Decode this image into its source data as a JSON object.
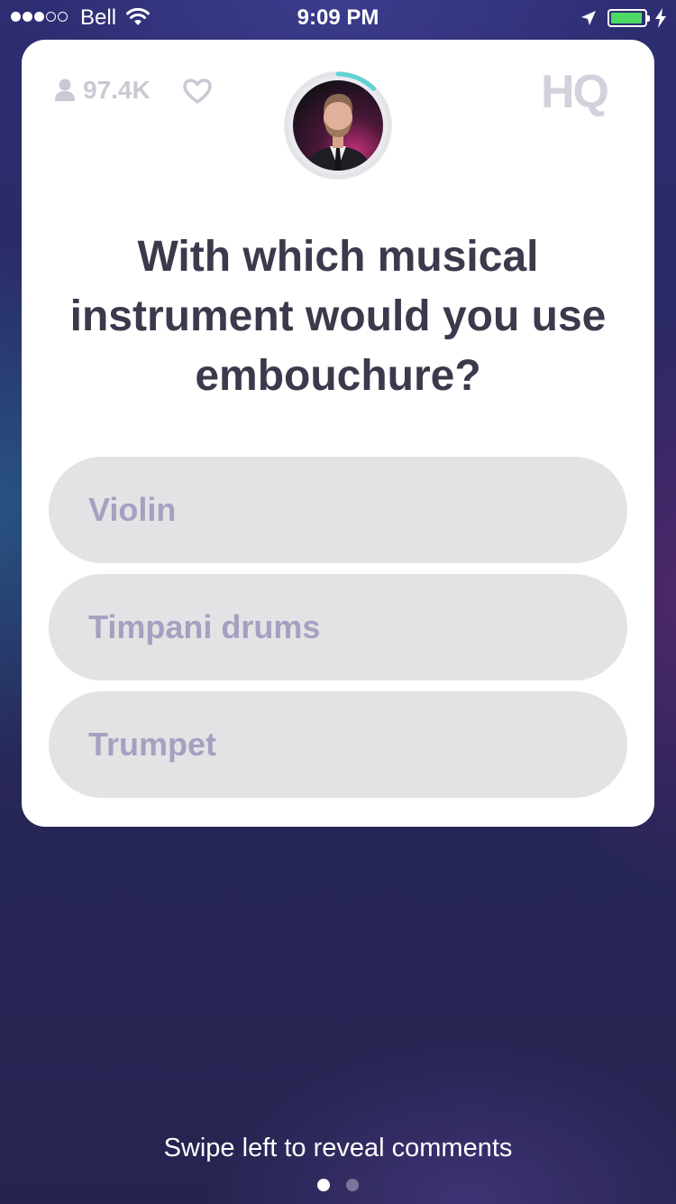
{
  "status_bar": {
    "carrier": "Bell",
    "time": "9:09 PM",
    "signal_bars_filled": 3,
    "signal_bars_total": 5,
    "battery_level": 0.95,
    "battery_color": "#4cd964",
    "icons": [
      "wifi-icon",
      "location-arrow-icon",
      "battery-icon",
      "charging-bolt-icon"
    ]
  },
  "header": {
    "viewer_count": "97.4K",
    "viewer_icon": "person-icon",
    "like_icon": "heart-icon",
    "logo_text": "HQ",
    "timer_progress": 0.18,
    "timer_color": "#5fd3d3"
  },
  "question": {
    "text": "With which musical instrument would you use embouchure?"
  },
  "answers": [
    {
      "label": "Violin"
    },
    {
      "label": "Timpani drums"
    },
    {
      "label": "Trumpet"
    }
  ],
  "footer": {
    "hint": "Swipe left to reveal comments",
    "page_count": 2,
    "current_page": 1
  },
  "colors": {
    "card_background": "#ffffff",
    "question_text": "#3a3a4c",
    "answer_background": "#e3e3e5",
    "answer_text": "#a4a1c0",
    "logo": "#d2d2dd"
  }
}
